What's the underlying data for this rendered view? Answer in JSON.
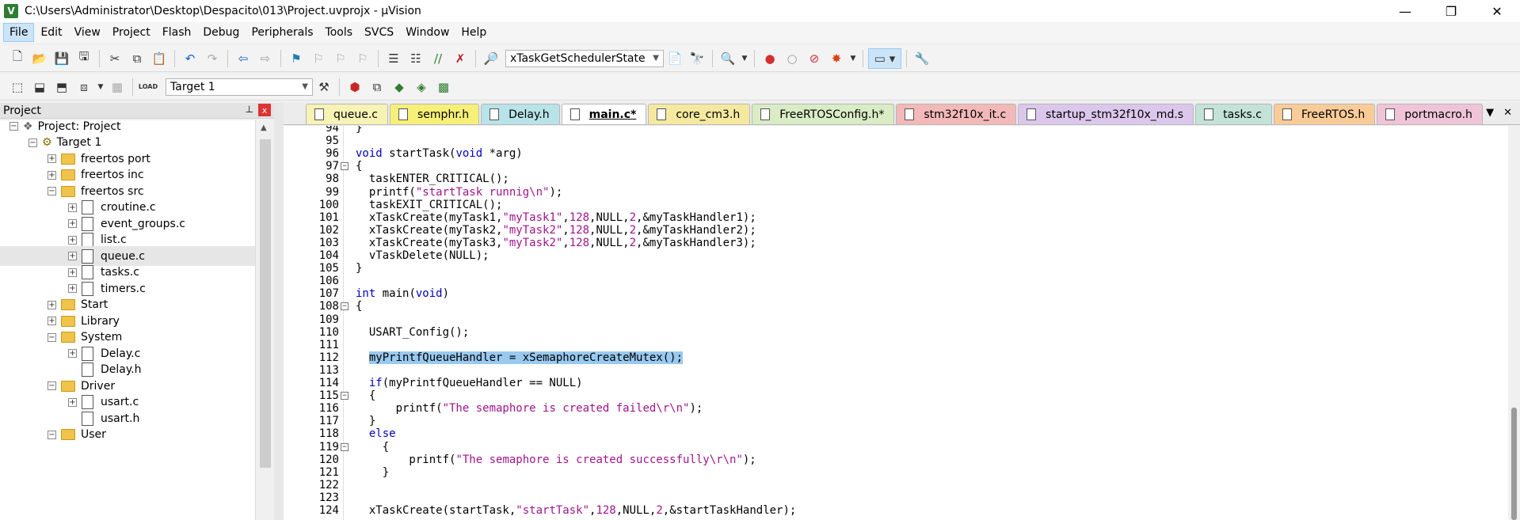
{
  "window": {
    "title": "C:\\Users\\Administrator\\Desktop\\Despacito\\013\\Project.uvprojx - µVision",
    "minimize": "—",
    "maximize": "❐",
    "close": "✕"
  },
  "menu": [
    "File",
    "Edit",
    "View",
    "Project",
    "Flash",
    "Debug",
    "Peripherals",
    "Tools",
    "SVCS",
    "Window",
    "Help"
  ],
  "toolbar1": {
    "function_combo": "xTaskGetSchedulerState"
  },
  "toolbar2": {
    "load_label": "LOAD",
    "target_combo": "Target 1"
  },
  "project_panel": {
    "title": "Project",
    "pin": "⊥",
    "close": "x",
    "tree": [
      {
        "label": "Project: Project",
        "expander": "−",
        "icon": "project",
        "indent": 12
      },
      {
        "label": "Target 1",
        "expander": "−",
        "icon": "target",
        "indent": 36
      },
      {
        "label": "freertos port",
        "expander": "+",
        "icon": "folder",
        "indent": 60
      },
      {
        "label": "freertos inc",
        "expander": "+",
        "icon": "folder",
        "indent": 60
      },
      {
        "label": "freertos src",
        "expander": "−",
        "icon": "folder",
        "indent": 60
      },
      {
        "label": "croutine.c",
        "expander": "+",
        "icon": "file",
        "indent": 86
      },
      {
        "label": "event_groups.c",
        "expander": "+",
        "icon": "file",
        "indent": 86
      },
      {
        "label": "list.c",
        "expander": "+",
        "icon": "file",
        "indent": 86
      },
      {
        "label": "queue.c",
        "expander": "+",
        "icon": "file",
        "indent": 86,
        "selected": true
      },
      {
        "label": "tasks.c",
        "expander": "+",
        "icon": "file",
        "indent": 86
      },
      {
        "label": "timers.c",
        "expander": "+",
        "icon": "file",
        "indent": 86
      },
      {
        "label": "Start",
        "expander": "+",
        "icon": "folder",
        "indent": 60
      },
      {
        "label": "Library",
        "expander": "+",
        "icon": "folder",
        "indent": 60
      },
      {
        "label": "System",
        "expander": "−",
        "icon": "folder",
        "indent": 60
      },
      {
        "label": "Delay.c",
        "expander": "+",
        "icon": "file",
        "indent": 86
      },
      {
        "label": "Delay.h",
        "expander": "",
        "icon": "file",
        "indent": 86
      },
      {
        "label": "Driver",
        "expander": "−",
        "icon": "folder",
        "indent": 60
      },
      {
        "label": "usart.c",
        "expander": "+",
        "icon": "file",
        "indent": 86
      },
      {
        "label": "usart.h",
        "expander": "",
        "icon": "file",
        "indent": 86
      },
      {
        "label": "User",
        "expander": "−",
        "icon": "folder",
        "indent": 60
      }
    ]
  },
  "tabs": [
    {
      "label": "queue.c",
      "color": "#f7f3b5"
    },
    {
      "label": "semphr.h",
      "color": "#f7f078"
    },
    {
      "label": "Delay.h",
      "color": "#b8e3e8"
    },
    {
      "label": "main.c*",
      "color": "#ffffff",
      "active": true
    },
    {
      "label": "core_cm3.h",
      "color": "#f5e9a0"
    },
    {
      "label": "FreeRTOSConfig.h*",
      "color": "#d9ecc5"
    },
    {
      "label": "stm32f10x_it.c",
      "color": "#f3b9b9"
    },
    {
      "label": "startup_stm32f10x_md.s",
      "color": "#dcc7ec"
    },
    {
      "label": "tasks.c",
      "color": "#c4e3d8"
    },
    {
      "label": "FreeRTOS.h",
      "color": "#f9cc97"
    },
    {
      "label": "portmacro.h",
      "color": "#f0c4d8"
    }
  ],
  "tab_controls": {
    "dropdown": "▼",
    "close": "✕"
  },
  "code_lines": [
    {
      "n": "94",
      "fold": "",
      "segs": [
        {
          "t": "}"
        }
      ]
    },
    {
      "n": "95",
      "fold": "",
      "segs": []
    },
    {
      "n": "96",
      "fold": "",
      "segs": [
        {
          "t": "void",
          "c": "kw"
        },
        {
          "t": " startTask("
        },
        {
          "t": "void",
          "c": "kw"
        },
        {
          "t": " *arg)"
        }
      ]
    },
    {
      "n": "97",
      "fold": "−",
      "segs": [
        {
          "t": "{"
        }
      ]
    },
    {
      "n": "98",
      "fold": "",
      "segs": [
        {
          "t": "  taskENTER_CRITICAL();"
        }
      ]
    },
    {
      "n": "99",
      "fold": "",
      "segs": [
        {
          "t": "  printf("
        },
        {
          "t": "\"startTask runnig\\n\"",
          "c": "str"
        },
        {
          "t": ");"
        }
      ]
    },
    {
      "n": "100",
      "fold": "",
      "segs": [
        {
          "t": "  taskEXIT_CRITICAL();"
        }
      ]
    },
    {
      "n": "101",
      "fold": "",
      "segs": [
        {
          "t": "  xTaskCreate(myTask1,"
        },
        {
          "t": "\"myTask1\"",
          "c": "str"
        },
        {
          "t": ","
        },
        {
          "t": "128",
          "c": "str"
        },
        {
          "t": ",NULL,"
        },
        {
          "t": "2",
          "c": "str"
        },
        {
          "t": ",&myTaskHandler1);"
        }
      ]
    },
    {
      "n": "102",
      "fold": "",
      "segs": [
        {
          "t": "  xTaskCreate(myTask2,"
        },
        {
          "t": "\"myTask2\"",
          "c": "str"
        },
        {
          "t": ","
        },
        {
          "t": "128",
          "c": "str"
        },
        {
          "t": ",NULL,"
        },
        {
          "t": "2",
          "c": "str"
        },
        {
          "t": ",&myTaskHandler2);"
        }
      ]
    },
    {
      "n": "103",
      "fold": "",
      "segs": [
        {
          "t": "  xTaskCreate(myTask3,"
        },
        {
          "t": "\"myTask2\"",
          "c": "str"
        },
        {
          "t": ","
        },
        {
          "t": "128",
          "c": "str"
        },
        {
          "t": ",NULL,"
        },
        {
          "t": "2",
          "c": "str"
        },
        {
          "t": ",&myTaskHandler3);"
        }
      ]
    },
    {
      "n": "104",
      "fold": "",
      "segs": [
        {
          "t": "  vTaskDelete(NULL);"
        }
      ]
    },
    {
      "n": "105",
      "fold": "",
      "segs": [
        {
          "t": "}"
        }
      ]
    },
    {
      "n": "106",
      "fold": "",
      "segs": []
    },
    {
      "n": "107",
      "fold": "",
      "segs": [
        {
          "t": "int",
          "c": "kw"
        },
        {
          "t": " main("
        },
        {
          "t": "void",
          "c": "kw"
        },
        {
          "t": ")"
        }
      ]
    },
    {
      "n": "108",
      "fold": "−",
      "segs": [
        {
          "t": "{"
        }
      ]
    },
    {
      "n": "109",
      "fold": "",
      "segs": []
    },
    {
      "n": "110",
      "fold": "",
      "segs": [
        {
          "t": "  USART_Config();"
        }
      ]
    },
    {
      "n": "111",
      "fold": "",
      "segs": []
    },
    {
      "n": "112",
      "fold": "",
      "segs": [
        {
          "t": "  "
        },
        {
          "t": "myPrintfQueueHandler = xSemaphoreCreateMutex();",
          "c": "hl"
        }
      ]
    },
    {
      "n": "113",
      "fold": "",
      "segs": []
    },
    {
      "n": "114",
      "fold": "",
      "segs": [
        {
          "t": "  "
        },
        {
          "t": "if",
          "c": "kw"
        },
        {
          "t": "(myPrintfQueueHandler == NULL)"
        }
      ]
    },
    {
      "n": "115",
      "fold": "−",
      "segs": [
        {
          "t": "  {"
        }
      ]
    },
    {
      "n": "116",
      "fold": "",
      "segs": [
        {
          "t": "      printf("
        },
        {
          "t": "\"The semaphore is created failed\\r\\n\"",
          "c": "str"
        },
        {
          "t": ");"
        }
      ]
    },
    {
      "n": "117",
      "fold": "",
      "segs": [
        {
          "t": "  }"
        }
      ]
    },
    {
      "n": "118",
      "fold": "",
      "segs": [
        {
          "t": "  "
        },
        {
          "t": "else",
          "c": "kw"
        }
      ]
    },
    {
      "n": "119",
      "fold": "−",
      "segs": [
        {
          "t": "    {"
        }
      ]
    },
    {
      "n": "120",
      "fold": "",
      "segs": [
        {
          "t": "        printf("
        },
        {
          "t": "\"The semaphore is created successfully\\r\\n\"",
          "c": "str"
        },
        {
          "t": ");"
        }
      ]
    },
    {
      "n": "121",
      "fold": "",
      "segs": [
        {
          "t": "    }"
        }
      ]
    },
    {
      "n": "122",
      "fold": "",
      "segs": []
    },
    {
      "n": "123",
      "fold": "",
      "segs": []
    },
    {
      "n": "124",
      "fold": "",
      "segs": [
        {
          "t": "  xTaskCreate(startTask,"
        },
        {
          "t": "\"startTask\"",
          "c": "str"
        },
        {
          "t": ","
        },
        {
          "t": "128",
          "c": "str"
        },
        {
          "t": ",NULL,"
        },
        {
          "t": "2",
          "c": "str"
        },
        {
          "t": ",&startTaskHandler);"
        }
      ]
    }
  ]
}
